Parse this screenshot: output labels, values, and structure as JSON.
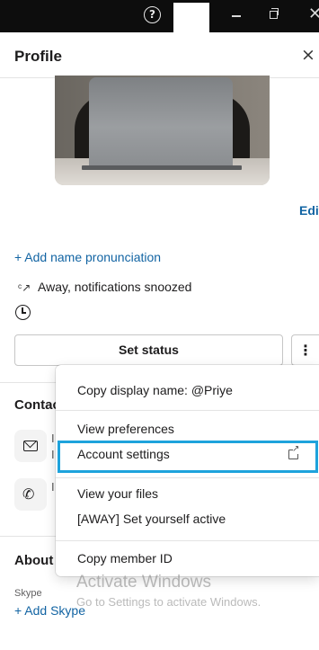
{
  "titlebar": {
    "help_glyph": "?",
    "minimize_glyph": "–",
    "close_glyph": "✕"
  },
  "panel": {
    "title": "Profile",
    "close_glyph": "×",
    "edit_label": "Edit"
  },
  "profile": {
    "add_name_pronunciation": "+ Add name pronunciation",
    "status_text": "Away, notifications snoozed",
    "set_status_label": "Set status",
    "more_glyph": "⋮"
  },
  "contact": {
    "heading": "Contac",
    "email_fragment_1": "I",
    "email_fragment_2": "I",
    "phone_fragment": "I"
  },
  "about": {
    "heading": "About",
    "skype_label": "Skype",
    "add_skype": "+ Add Skype"
  },
  "menu": {
    "items": [
      {
        "label": "Copy display name: @Priye"
      },
      {
        "label": "View preferences"
      },
      {
        "label": "Account settings",
        "external": true,
        "highlighted": true
      },
      {
        "label": "View your files"
      },
      {
        "label": "[AWAY] Set yourself active"
      },
      {
        "label": "Copy member ID"
      }
    ]
  },
  "watermark": {
    "title": "Activate Windows",
    "subtitle": "Go to Settings to activate Windows."
  },
  "colors": {
    "link": "#1264a3",
    "highlight_border": "#1ea3dc",
    "titlebar": "#0d0d0d"
  },
  "icons": [
    "help-icon",
    "minimize-icon",
    "maximize-icon",
    "close-icon",
    "snooze-icon",
    "clock-icon",
    "more-icon",
    "mail-icon",
    "phone-icon",
    "external-link-icon"
  ]
}
